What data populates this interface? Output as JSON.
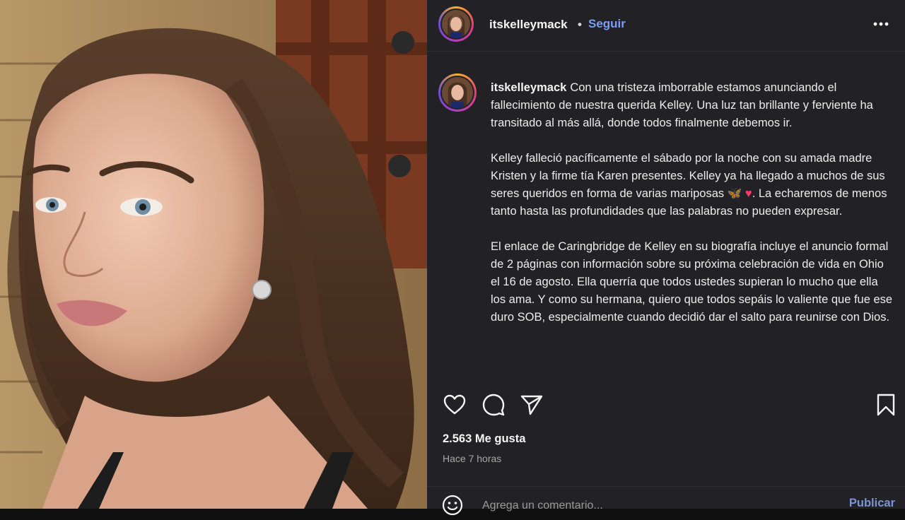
{
  "post": {
    "username": "itskelleymack",
    "follow_label": "Seguir",
    "separator": "•",
    "caption_paragraphs": [
      "Con una tristeza imborrable estamos anunciando el fallecimiento de nuestra querida Kelley. Una luz tan brillante y ferviente ha transitado al más allá, donde todos finalmente debemos ir.",
      "Kelley falleció pacíficamente el sábado por la noche con su amada madre Kristen y la firme tía Karen presentes. Kelley ya ha llegado a muchos de sus seres queridos en forma de varias mariposas",
      "El enlace de Caringbridge de Kelley en su biografía incluye el anuncio formal de 2 páginas con información sobre su próxima celebración de vida en Ohio el 16 de agosto. Ella querría que todos ustedes supieran lo mucho que ella los ama. Y como su hermana, quiero que todos sepáis lo valiente que fue ese duro SOB, especialmente cuando decidió dar el salto para reunirse con Dios."
    ],
    "caption_p2_tail": ". La echaremos de menos tanto hasta las profundidades que las palabras no pueden expresar.",
    "emoji_butterfly": "🦋",
    "emoji_heart": "♥",
    "likes": "2.563 Me gusta",
    "time_ago": "Hace 7 horas",
    "comment_placeholder": "Agrega un comentario...",
    "publish_label": "Publicar"
  },
  "icons": {
    "more": "more-options-icon",
    "like": "heart-icon",
    "comment": "comment-icon",
    "share": "send-icon",
    "save": "bookmark-icon",
    "emoji": "emoji-icon"
  },
  "colors": {
    "panel_bg": "#222126",
    "link_blue": "#7d9cf5",
    "text": "#f5f5f5",
    "muted": "#a8a8a8"
  }
}
